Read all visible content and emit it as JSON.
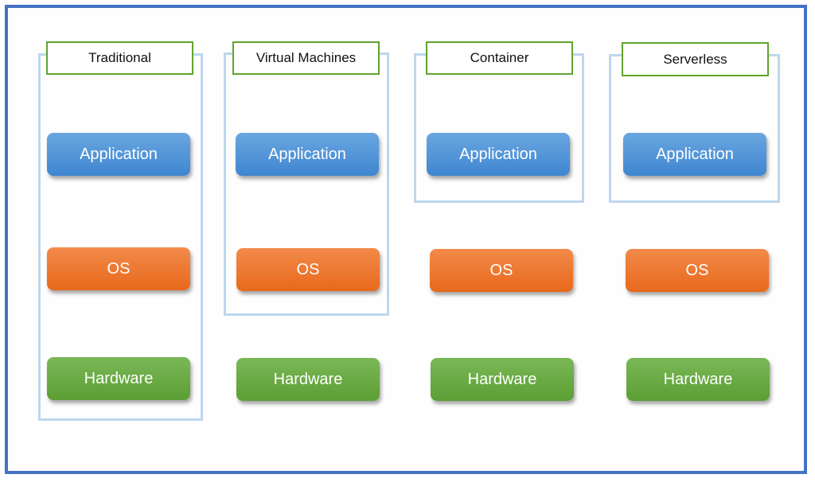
{
  "diagram": {
    "columns": [
      {
        "title": "Traditional",
        "layers": [
          "Application",
          "OS",
          "Hardware"
        ],
        "group_covers": [
          "Application",
          "OS",
          "Hardware"
        ]
      },
      {
        "title": "Virtual Machines",
        "layers": [
          "Application",
          "OS",
          "Hardware"
        ],
        "group_covers": [
          "Application",
          "OS"
        ]
      },
      {
        "title": "Container",
        "layers": [
          "Application",
          "OS",
          "Hardware"
        ],
        "group_covers": [
          "Application"
        ]
      },
      {
        "title": "Serverless",
        "layers": [
          "Application",
          "OS",
          "Hardware"
        ],
        "group_covers": [
          "Application"
        ]
      }
    ],
    "colors": {
      "frame": "#4472c4",
      "group_border": "#bdd7ee",
      "label_border": "#5fa32e",
      "application": "#4a90d9",
      "os": "#ed7d31",
      "hardware": "#70ad47"
    }
  }
}
